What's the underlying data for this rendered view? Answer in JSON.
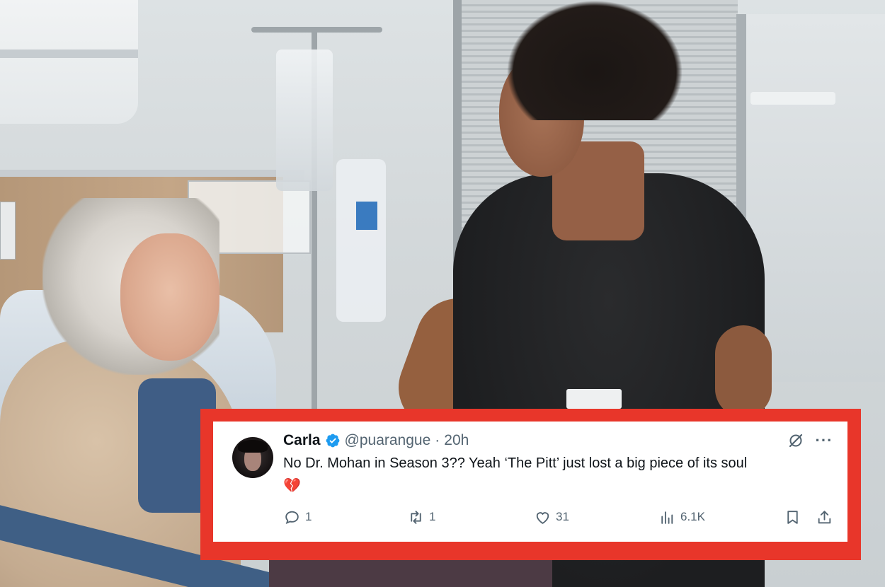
{
  "tweet": {
    "display_name": "Carla",
    "handle": "@puarangue",
    "separator": "·",
    "time": "20h",
    "text": "No Dr. Mohan in Season 3?? Yeah ‘The Pitt’ just lost a big piece of its soul",
    "emoji": "💔",
    "icons": {
      "verified": "verified-badge-icon",
      "grok": "grok-icon",
      "more": "more-icon",
      "reply": "reply-icon",
      "retweet": "retweet-icon",
      "like": "like-icon",
      "views": "views-icon",
      "bookmark": "bookmark-icon",
      "share": "share-icon"
    },
    "metrics": {
      "replies": "1",
      "retweets": "1",
      "likes": "31",
      "views": "6.1K"
    }
  },
  "colors": {
    "frame_red": "#e8362a",
    "verified_blue": "#1d9bf0",
    "muted_text": "#536471",
    "primary_text": "#0f1419"
  }
}
